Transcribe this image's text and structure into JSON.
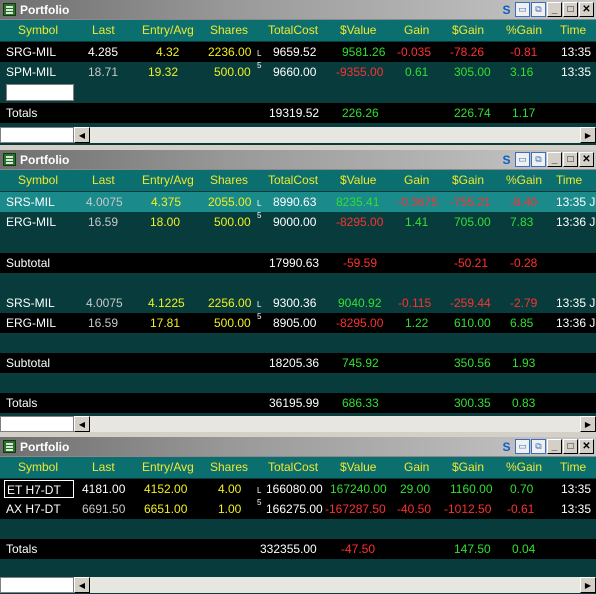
{
  "columns": [
    "Symbol",
    "Last",
    "Entry/Avg",
    "Shares",
    "TotalCost",
    "$Value",
    "Gain",
    "$Gain",
    "%Gain",
    "Time"
  ],
  "window_title": "Portfolio",
  "title_buttons": {
    "s": "S",
    "minimize": "_",
    "maximize": "□",
    "close": "✕"
  },
  "scroll": {
    "left": "◀",
    "right": "▶"
  },
  "w1": {
    "rows": [
      {
        "symbol": "SRG-MIL",
        "last": "4.285",
        "entry": "4.32",
        "shares": "2236.00",
        "level": "L",
        "cost": "9659.52",
        "value": "9581.26",
        "gain": "-0.035",
        "dgain": "-78.26",
        "pgain": "-0.81",
        "time": "13:35"
      },
      {
        "symbol": "SPM-MIL",
        "last": "18.71",
        "entry": "19.32",
        "shares": "500.00",
        "level": "5",
        "cost": "9660.00",
        "value": "-9355.00",
        "gain": "0.61",
        "dgain": "305.00",
        "pgain": "3.16",
        "time": "13:35"
      }
    ],
    "totals": {
      "label": "Totals",
      "cost": "19319.52",
      "value": "226.26",
      "dgain": "226.74",
      "pgain": "1.17"
    }
  },
  "w2": {
    "group1": [
      {
        "symbol": "SRS-MIL",
        "last": "4.0075",
        "entry": "4.375",
        "shares": "2055.00",
        "level": "L",
        "cost": "8990.63",
        "value": "8235.41",
        "gain": "-0.3675",
        "dgain": "-755.21",
        "pgain": "-8.40",
        "time": "13:35 J"
      },
      {
        "symbol": "ERG-MIL",
        "last": "16.59",
        "entry": "18.00",
        "shares": "500.00",
        "level": "5",
        "cost": "9000.00",
        "value": "-8295.00",
        "gain": "1.41",
        "dgain": "705.00",
        "pgain": "7.83",
        "time": "13:36 J"
      }
    ],
    "subtotal1": {
      "label": "Subtotal",
      "cost": "17990.63",
      "value": "-59.59",
      "dgain": "-50.21",
      "pgain": "-0.28"
    },
    "group2": [
      {
        "symbol": "SRS-MIL",
        "last": "4.0075",
        "entry": "4.1225",
        "shares": "2256.00",
        "level": "L",
        "cost": "9300.36",
        "value": "9040.92",
        "gain": "-0.115",
        "dgain": "-259.44",
        "pgain": "-2.79",
        "time": "13:35 J"
      },
      {
        "symbol": "ERG-MIL",
        "last": "16.59",
        "entry": "17.81",
        "shares": "500.00",
        "level": "5",
        "cost": "8905.00",
        "value": "-8295.00",
        "gain": "1.22",
        "dgain": "610.00",
        "pgain": "6.85",
        "time": "13:36 J"
      }
    ],
    "subtotal2": {
      "label": "Subtotal",
      "cost": "18205.36",
      "value": "745.92",
      "dgain": "350.56",
      "pgain": "1.93"
    },
    "totals": {
      "label": "Totals",
      "cost": "36195.99",
      "value": "686.33",
      "dgain": "300.35",
      "pgain": "0.83"
    }
  },
  "w3": {
    "rows": [
      {
        "symbol": "ET H7-DT",
        "last": "4181.00",
        "entry": "4152.00",
        "shares": "4.00",
        "level": "L",
        "cost": "166080.00",
        "value": "167240.00",
        "gain": "29.00",
        "dgain": "1160.00",
        "pgain": "0.70",
        "time": "13:35"
      },
      {
        "symbol": "AX H7-DT",
        "last": "6691.50",
        "entry": "6651.00",
        "shares": "1.00",
        "level": "5",
        "cost": "166275.00",
        "value": "-167287.50",
        "gain": "-40.50",
        "dgain": "-1012.50",
        "pgain": "-0.61",
        "time": "13:35"
      }
    ],
    "totals": {
      "label": "Totals",
      "cost": "332355.00",
      "value": "-47.50",
      "dgain": "147.50",
      "pgain": "0.04"
    }
  }
}
